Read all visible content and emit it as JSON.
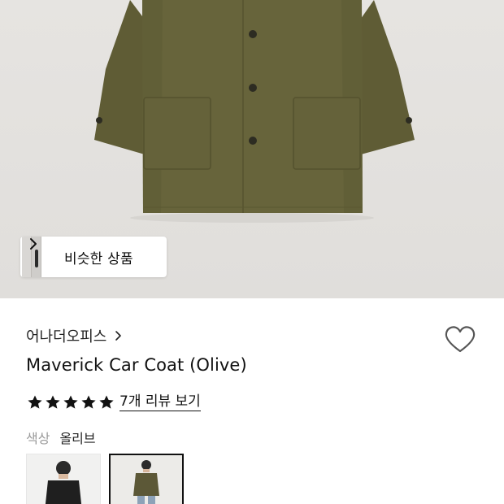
{
  "similar_products": {
    "label": "비슷한 상품"
  },
  "product": {
    "brand": "어나더오피스",
    "title": "Maverick Car Coat (Olive)",
    "rating_stars": 5,
    "review_link": "7개 리뷰 보기",
    "color_label": "색상",
    "color_value": "올리브"
  },
  "swatches": [
    {
      "color": "Black"
    },
    {
      "color": "Olive",
      "selected": true
    }
  ],
  "colors": {
    "coat_olive": "#65623a",
    "hero_bg": "#e4e2df",
    "text": "#111111",
    "muted": "#9a9a9a"
  },
  "icons": {
    "chip_chevron": "chevron-right-icon",
    "brand_chevron": "chevron-right-icon",
    "wishlist": "heart-outline-icon",
    "star": "star-filled-icon"
  }
}
